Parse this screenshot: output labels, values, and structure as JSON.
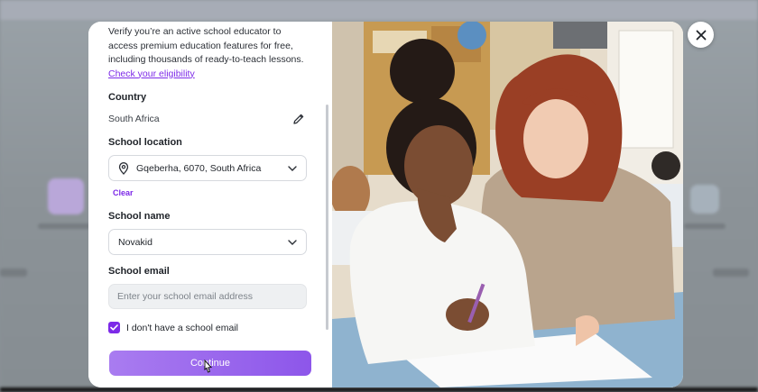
{
  "intro": {
    "text": "Verify you’re an active school educator to access premium education features for free, including thousands of ready-to-teach lessons.",
    "link": "Check your eligibility"
  },
  "country": {
    "label": "Country",
    "value": "South Africa",
    "icon": "pencil-icon"
  },
  "school_location": {
    "label": "School location",
    "value": "Gqeberha, 6070, South Africa",
    "icon": "map-pin-icon",
    "clear_label": "Clear"
  },
  "school_name": {
    "label": "School name",
    "value": "Novakid"
  },
  "school_email": {
    "label": "School email",
    "placeholder": "Enter your school email address"
  },
  "no_email": {
    "label": "I don't have a school email",
    "checked": true
  },
  "continue_label": "Continue",
  "colors": {
    "accent": "#7d2ae8",
    "button_start": "#a97cf0",
    "button_end": "#8d56ea"
  }
}
